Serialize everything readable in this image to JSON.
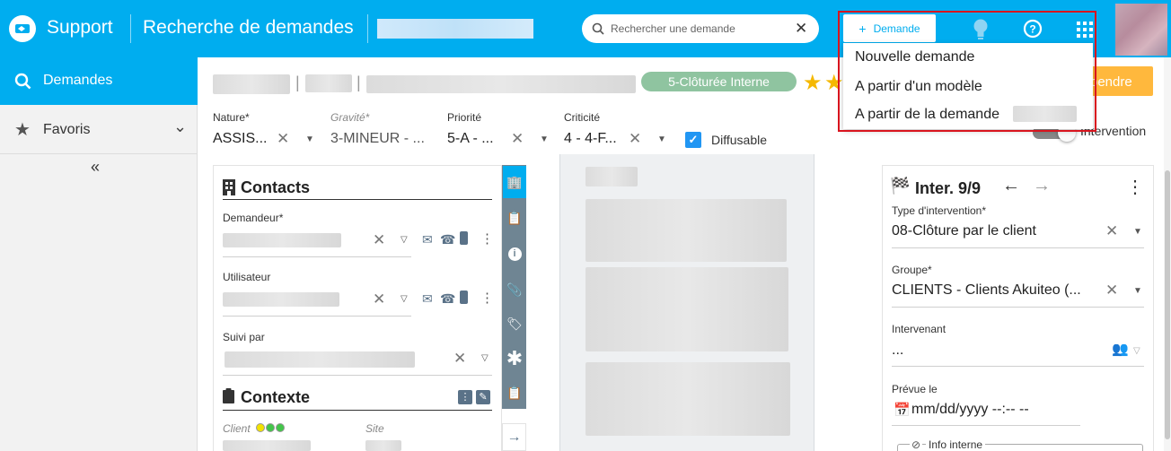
{
  "topbar": {
    "app": "Support",
    "page_title": "Recherche de demandes",
    "search_placeholder": "Rechercher une demande",
    "new_request_btn": "Demande"
  },
  "dropdown": {
    "items": [
      "Nouvelle demande",
      "A partir d'un modèle",
      "A partir de la demande"
    ]
  },
  "sidebar": {
    "demandes": "Demandes",
    "favoris": "Favoris"
  },
  "header": {
    "status": "5-Clôturée Interne",
    "suspend_btn": "Suspendre",
    "suspend_visible": "pendre"
  },
  "fields": {
    "nature": {
      "label": "Nature*",
      "value": "ASSIS..."
    },
    "gravite": {
      "label": "Gravité*",
      "value": "3-MINEUR - ..."
    },
    "priorite": {
      "label": "Priorité",
      "value": "5-A - ..."
    },
    "criticite": {
      "label": "Criticité",
      "value": "4 - 4-F..."
    },
    "diffusable": "Diffusable",
    "intervention": "Intervention"
  },
  "contacts": {
    "title": "Contacts",
    "demandeur": "Demandeur*",
    "utilisateur": "Utilisateur",
    "suivi_par": "Suivi par"
  },
  "contexte": {
    "title": "Contexte",
    "client": "Client",
    "site": "Site"
  },
  "intervention_panel": {
    "title": "Inter. 9/9",
    "type_label": "Type d'intervention*",
    "type_value": "08-Clôture par le client",
    "groupe_label": "Groupe*",
    "groupe_value": "CLIENTS - Clients Akuiteo (...",
    "intervenant_label": "Intervenant",
    "intervenant_value": "...",
    "prevue_label": "Prévue le",
    "prevue_value": "mm/dd/yyyy --:-- --",
    "info_interne": "Info interne"
  },
  "colors": {
    "topbar": "#00adef",
    "status_badge": "#8fc4a0",
    "highlight": "#d9141e",
    "star": "#f5b800",
    "checkbox": "#2196f3"
  }
}
